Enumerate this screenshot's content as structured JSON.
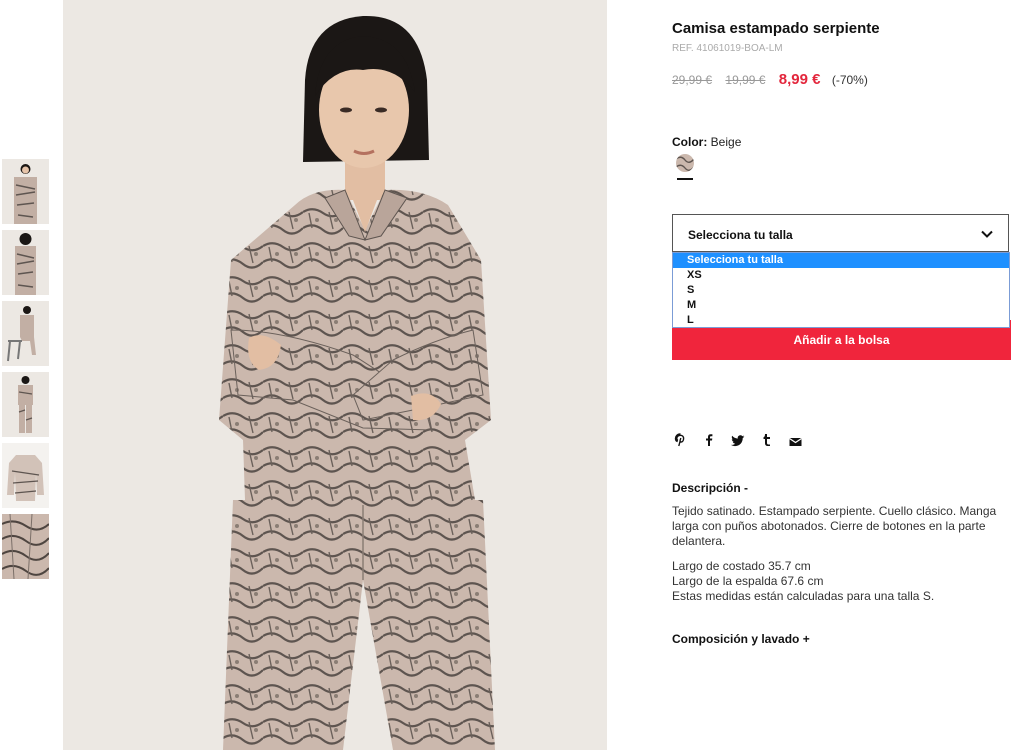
{
  "product": {
    "title": "Camisa estampado serpiente",
    "ref": "REF. 41061019-BOA-LM",
    "prices": {
      "original": "29,99 €",
      "previous": "19,99 €",
      "current": "8,99 €",
      "discount": "(-70%)"
    },
    "color": {
      "label": "Color:",
      "value": "Beige"
    }
  },
  "size_select": {
    "label": "Selecciona tu talla",
    "options": [
      "Selecciona tu talla",
      "XS",
      "S",
      "M",
      "L"
    ],
    "selected_index": 0
  },
  "add_to_bag": "Añadir a la bolsa",
  "social": [
    "pinterest-icon",
    "facebook-icon",
    "twitter-icon",
    "tumblr-icon",
    "email-icon"
  ],
  "description": {
    "heading": "Descripción -",
    "text": "Tejido satinado. Estampado serpiente. Cuello clásico. Manga larga con puños abotonados. Cierre de botones en la parte delantera.",
    "measurements": [
      "Largo de costado 35.7 cm",
      "Largo de la espalda 67.6 cm",
      "Estas medidas están calculadas para una talla S."
    ]
  },
  "composition": {
    "heading": "Composición y lavado +"
  },
  "gallery": {
    "thumbnails": [
      "front-view",
      "back-view",
      "seated-view",
      "full-length-view",
      "flat-lay",
      "fabric-detail"
    ],
    "colors": {
      "background": "#ece8e3",
      "fabric": "#cbb8ad",
      "pattern": "#5e5550",
      "skin": "#e6c4aa",
      "hair": "#1b1715"
    }
  },
  "theme": {
    "accent": "#f0253c",
    "sale_price": "#e3263c",
    "dropdown_highlight": "#1e90ff"
  }
}
